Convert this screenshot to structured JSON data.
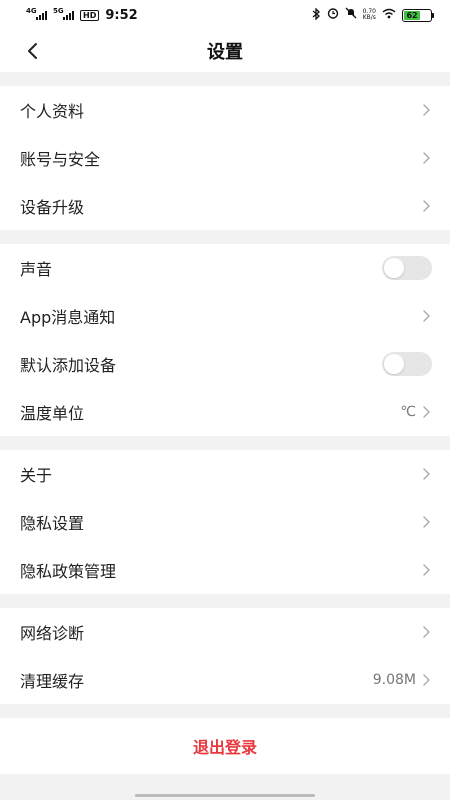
{
  "status_bar": {
    "net1": "4G",
    "net2": "5G",
    "hd": "HD",
    "time": "9:52",
    "speed_value": "0.70",
    "speed_unit": "KB/s",
    "battery": "62",
    "battery_level": 0.62
  },
  "navbar": {
    "title": "设置"
  },
  "groups": [
    {
      "items": [
        {
          "label": "个人资料"
        },
        {
          "label": "账号与安全"
        },
        {
          "label": "设备升级"
        }
      ]
    },
    {
      "items": [
        {
          "label": "声音",
          "toggle": false
        },
        {
          "label": "App消息通知"
        },
        {
          "label": "默认添加设备",
          "toggle": false
        },
        {
          "label": "温度单位",
          "value": "℃"
        }
      ]
    },
    {
      "items": [
        {
          "label": "关于"
        },
        {
          "label": "隐私设置"
        },
        {
          "label": "隐私政策管理"
        }
      ]
    },
    {
      "items": [
        {
          "label": "网络诊断"
        },
        {
          "label": "清理缓存",
          "value": "9.08M"
        }
      ]
    }
  ],
  "logout_label": "退出登录",
  "colors": {
    "accent_red": "#e8383d",
    "battery_green": "#3fc13f"
  }
}
